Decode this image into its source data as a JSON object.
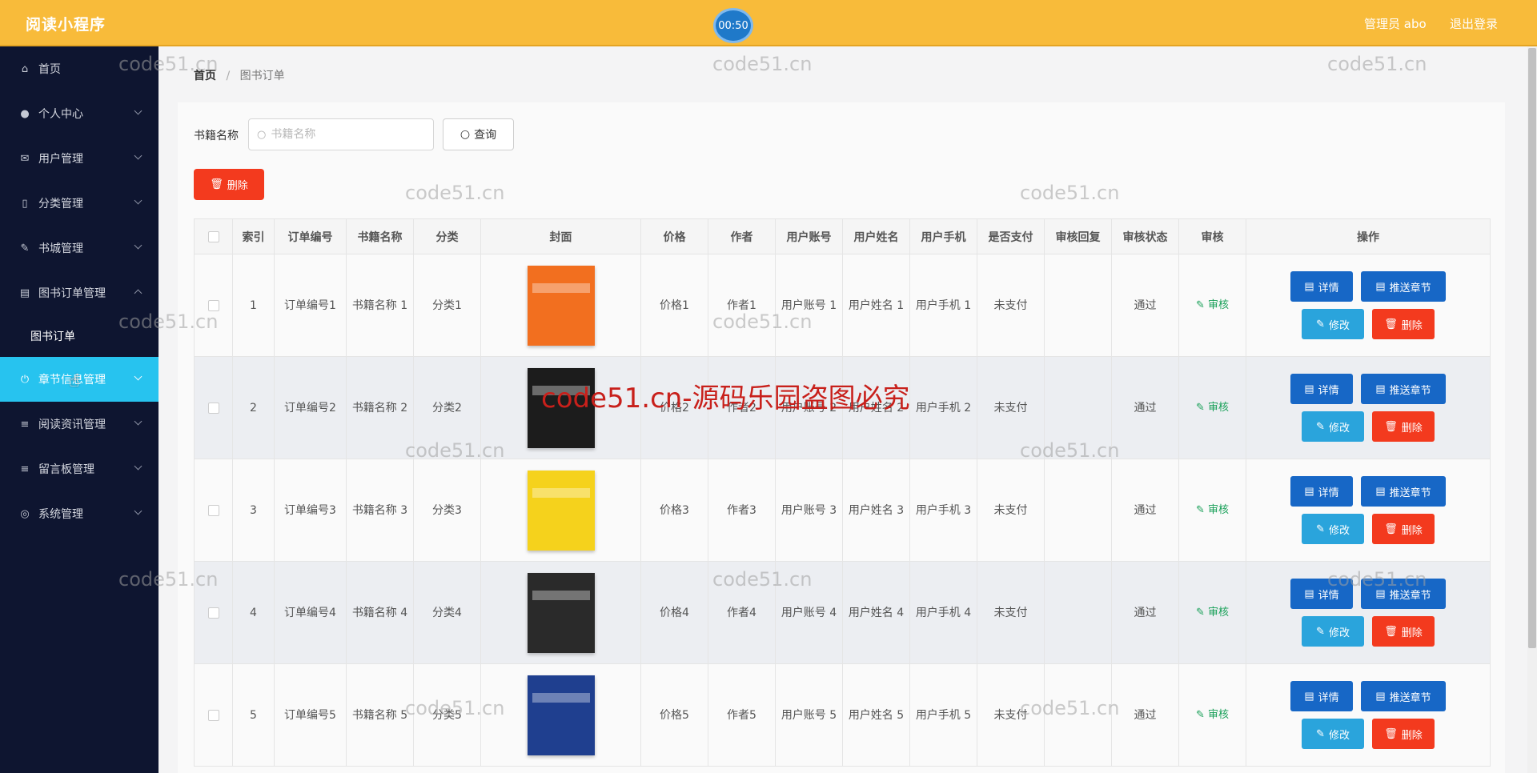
{
  "app": {
    "title": "阅读小程序",
    "timer": "00:50",
    "admin": "管理员 abo",
    "logout": "退出登录"
  },
  "sidebar": {
    "items": [
      {
        "label": "首页",
        "icon": "home-icon",
        "glyph": "⌂"
      },
      {
        "label": "个人中心",
        "icon": "user-icon",
        "glyph": "●"
      },
      {
        "label": "用户管理",
        "icon": "mail-icon",
        "glyph": "✉"
      },
      {
        "label": "分类管理",
        "icon": "tag-icon",
        "glyph": "▯"
      },
      {
        "label": "书城管理",
        "icon": "pen-icon",
        "glyph": "✎"
      },
      {
        "label": "图书订单管理",
        "icon": "bank-icon",
        "glyph": "▤"
      },
      {
        "label": "章节信息管理",
        "icon": "power-icon",
        "glyph": "⏻"
      },
      {
        "label": "阅读资讯管理",
        "icon": "menu-icon",
        "glyph": "≡"
      },
      {
        "label": "留言板管理",
        "icon": "menu-icon",
        "glyph": "≡"
      },
      {
        "label": "系统管理",
        "icon": "settings-icon",
        "glyph": "◎"
      }
    ],
    "submenu": "图书订单"
  },
  "breadcrumb": {
    "home": "首页",
    "separator": "/",
    "current": "图书订单"
  },
  "search": {
    "label": "书籍名称",
    "placeholder": "书籍名称",
    "button": "查询"
  },
  "toolbar": {
    "delete": "删除"
  },
  "table": {
    "headers": [
      "索引",
      "订单编号",
      "书籍名称",
      "分类",
      "封面",
      "价格",
      "作者",
      "用户账号",
      "用户姓名",
      "用户手机",
      "是否支付",
      "审核回复",
      "审核状态",
      "审核",
      "操作"
    ],
    "rows": [
      {
        "index": "1",
        "order_no": "订单编号1",
        "book_name": "书籍名称 1",
        "category": "分类1",
        "cover_color": "#f26f1f",
        "price": "价格1",
        "author": "作者1",
        "account": "用户账号 1",
        "name": "用户姓名 1",
        "phone": "用户手机 1",
        "paid": "未支付",
        "reply": "",
        "status": "通过",
        "review": "审核"
      },
      {
        "index": "2",
        "order_no": "订单编号2",
        "book_name": "书籍名称 2",
        "category": "分类2",
        "cover_color": "#1c1c1c",
        "price": "价格2",
        "author": "作者2",
        "account": "用户账号 2",
        "name": "用户姓名 2",
        "phone": "用户手机 2",
        "paid": "未支付",
        "reply": "",
        "status": "通过",
        "review": "审核"
      },
      {
        "index": "3",
        "order_no": "订单编号3",
        "book_name": "书籍名称 3",
        "category": "分类3",
        "cover_color": "#f5d21c",
        "price": "价格3",
        "author": "作者3",
        "account": "用户账号 3",
        "name": "用户姓名 3",
        "phone": "用户手机 3",
        "paid": "未支付",
        "reply": "",
        "status": "通过",
        "review": "审核"
      },
      {
        "index": "4",
        "order_no": "订单编号4",
        "book_name": "书籍名称 4",
        "category": "分类4",
        "cover_color": "#2a2a2a",
        "price": "价格4",
        "author": "作者4",
        "account": "用户账号 4",
        "name": "用户姓名 4",
        "phone": "用户手机 4",
        "paid": "未支付",
        "reply": "",
        "status": "通过",
        "review": "审核"
      },
      {
        "index": "5",
        "order_no": "订单编号5",
        "book_name": "书籍名称 5",
        "category": "分类5",
        "cover_color": "#1f3f8f",
        "price": "价格5",
        "author": "作者5",
        "account": "用户账号 5",
        "name": "用户姓名 5",
        "phone": "用户手机 5",
        "paid": "未支付",
        "reply": "",
        "status": "通过",
        "review": "审核"
      }
    ],
    "actions": {
      "detail": "详情",
      "push": "推送章节",
      "edit": "修改",
      "delete": "删除"
    }
  },
  "watermark": {
    "small": "code51.cn",
    "big": "code51.cn-源码乐园盗图必究"
  }
}
